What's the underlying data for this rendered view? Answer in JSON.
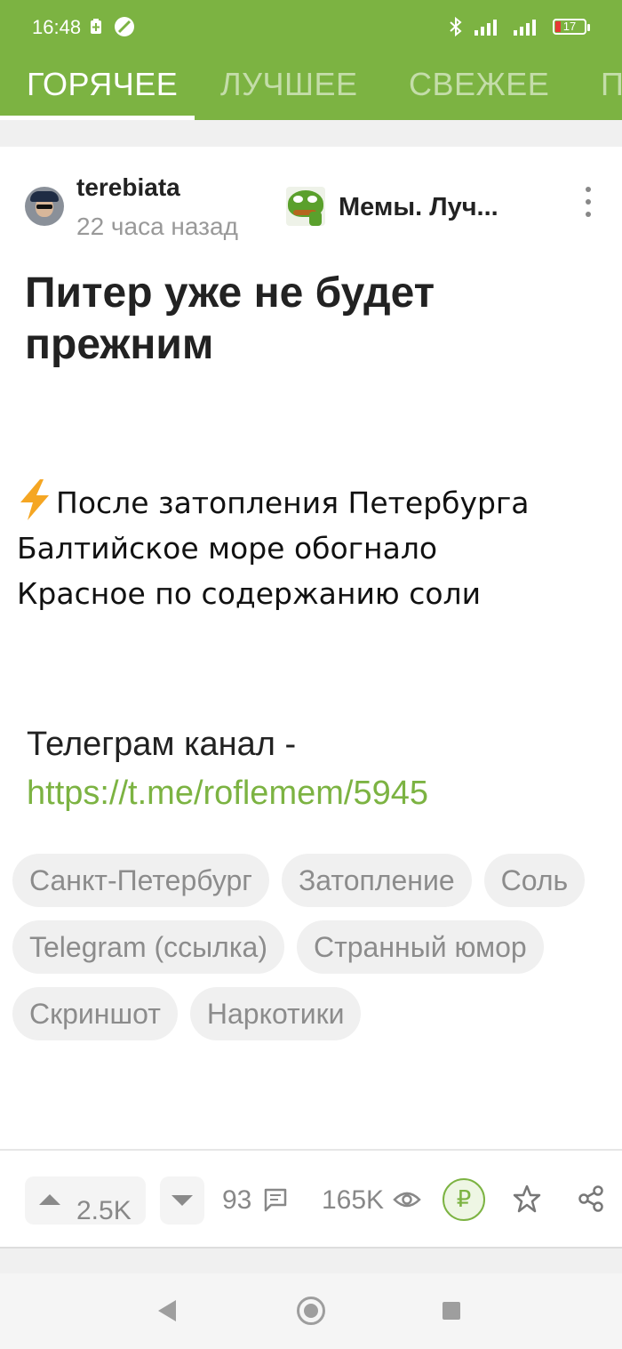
{
  "status_bar": {
    "time": "16:48",
    "battery": "17"
  },
  "tabs": [
    "ГОРЯЧЕЕ",
    "ЛУЧШЕЕ",
    "СВЕЖЕЕ",
    "П"
  ],
  "post": {
    "author": "terebiata",
    "time_ago": "22 часа назад",
    "community": "Мемы. Луч...",
    "title": "Питер уже не будет прежним",
    "quote_lines": [
      "После затопления Петербурга",
      "Балтийское море обогнало",
      "Красное по содержанию соли"
    ],
    "telegram_text": "Телеграм канал -",
    "telegram_link": "https://t.me/roflemem/5945",
    "tags": [
      "Санкт-Петербург",
      "Затопление",
      "Соль",
      "Telegram (ссылка)",
      "Странный юмор",
      "Скриншот",
      "Наркотики"
    ]
  },
  "actions": {
    "rating": "2.5K",
    "comments": "93",
    "views": "165K",
    "donate_symbol": "₽"
  },
  "colors": {
    "accent": "#7cb342"
  },
  "icons": [
    "bluetooth-icon",
    "signal-icon",
    "battery-icon",
    "comments-icon",
    "eye-icon",
    "star-icon",
    "share-icon",
    "more-icon"
  ]
}
